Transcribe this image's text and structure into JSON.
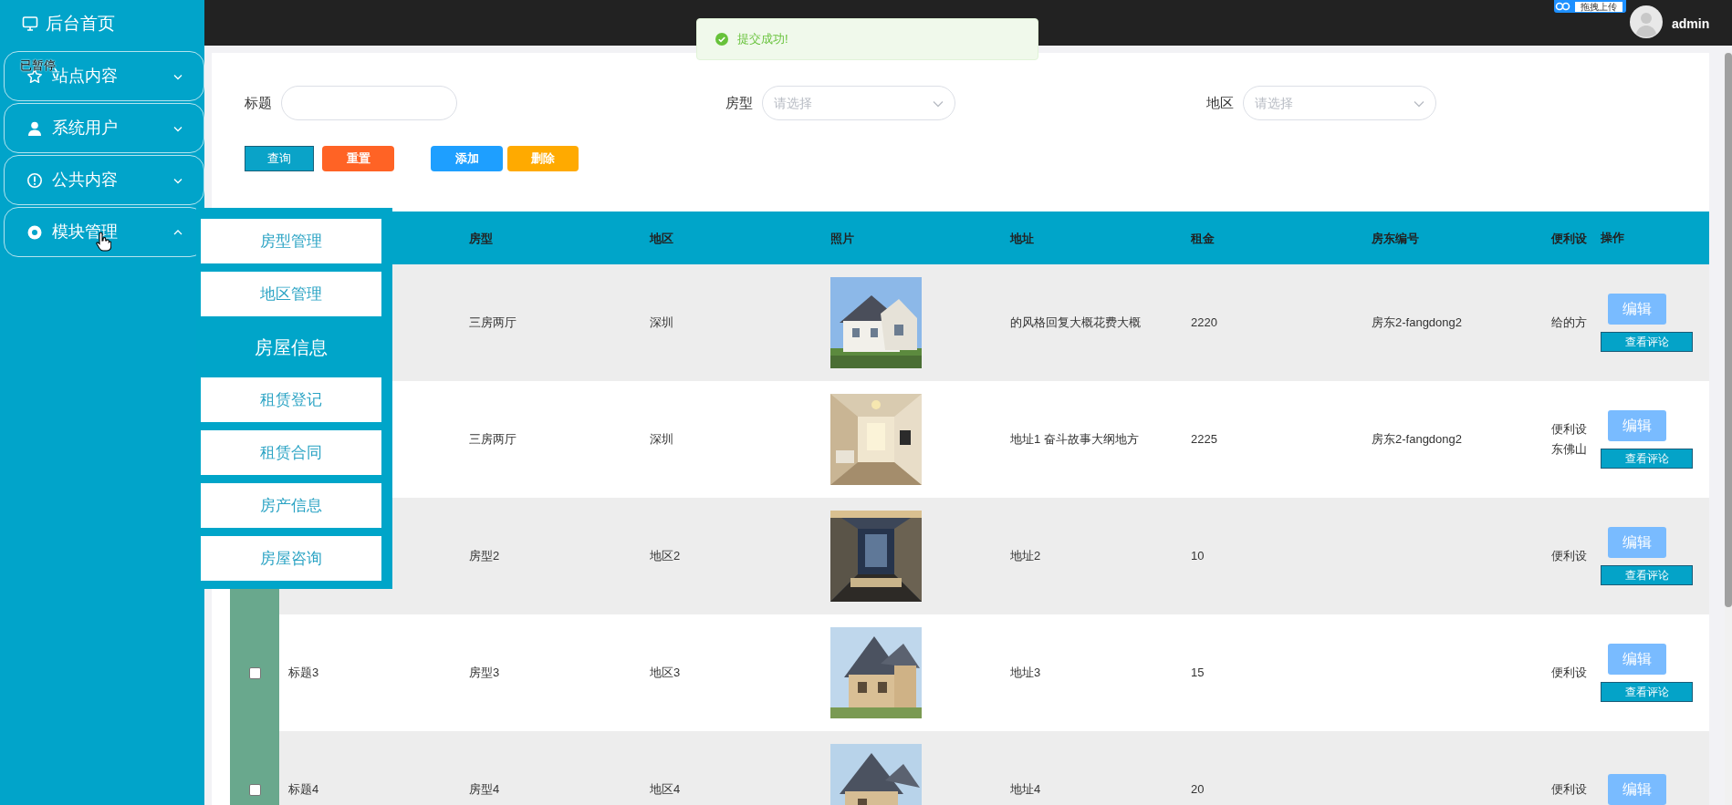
{
  "sidebar": {
    "home": {
      "label": "后台首页"
    },
    "paused_label": "已暂停",
    "items": [
      {
        "label": "站点内容",
        "expanded": false
      },
      {
        "label": "系统用户",
        "expanded": false
      },
      {
        "label": "公共内容",
        "expanded": false
      },
      {
        "label": "模块管理",
        "expanded": true
      }
    ]
  },
  "header": {
    "upload_badge": "拖拽上传",
    "user": "admin"
  },
  "toast": {
    "message": "提交成功!"
  },
  "filters": [
    {
      "label": "标题",
      "kind": "input"
    },
    {
      "label": "房型",
      "kind": "select",
      "placeholder": "请选择"
    },
    {
      "label": "地区",
      "kind": "select",
      "placeholder": "请选择"
    }
  ],
  "actions": [
    {
      "label": "查询",
      "kind": "search"
    },
    {
      "label": "重置",
      "kind": "reset"
    },
    {
      "label": "添加",
      "kind": "add"
    },
    {
      "label": "删除",
      "kind": "delete"
    }
  ],
  "submenu": {
    "items": [
      {
        "label": "房型管理",
        "kind": "item"
      },
      {
        "label": "地区管理",
        "kind": "item"
      },
      {
        "label": "房屋信息",
        "kind": "heading"
      },
      {
        "label": "租赁登记",
        "kind": "item"
      },
      {
        "label": "租赁合同",
        "kind": "item"
      },
      {
        "label": "房产信息",
        "kind": "item"
      },
      {
        "label": "房屋咨询",
        "kind": "item"
      }
    ]
  },
  "table": {
    "columns": [
      "房型",
      "地区",
      "照片",
      "地址",
      "租金",
      "房东编号",
      "便利设",
      "操作"
    ],
    "rows": [
      {
        "type": "三房两厅",
        "region": "深圳",
        "address": "的风格回复大概花费大概",
        "rent": "2220",
        "landlord": "房东2-fangdong2",
        "facilities": "给的方",
        "actions": [
          "编辑",
          "查看评论"
        ]
      },
      {
        "type": "三房两厅",
        "region": "深圳",
        "address": "地址1 奋斗故事大纲地方",
        "rent": "2225",
        "landlord": "房东2-fangdong2",
        "facilities": [
          "便利设",
          "东佛山"
        ],
        "actions": [
          "编辑",
          "查看评论"
        ]
      },
      {
        "type": "房型2",
        "region": "地区2",
        "address": "地址2",
        "rent": "10",
        "facilities": "便利设",
        "actions": [
          "编辑",
          "查看评论"
        ]
      },
      {
        "checkbox": {
          "checked": false
        },
        "title": "标题3",
        "type": "房型3",
        "region": "地区3",
        "address": "地址3",
        "rent": "15",
        "facilities": "便利设",
        "actions": [
          "编辑",
          "查看评论"
        ]
      },
      {
        "checkbox": {
          "checked": false
        },
        "title": "标题4",
        "type": "房型4",
        "region": "地区4",
        "address": "地址4",
        "rent": "20",
        "facilities": "便利设",
        "actions": [
          "编辑"
        ]
      }
    ]
  }
}
